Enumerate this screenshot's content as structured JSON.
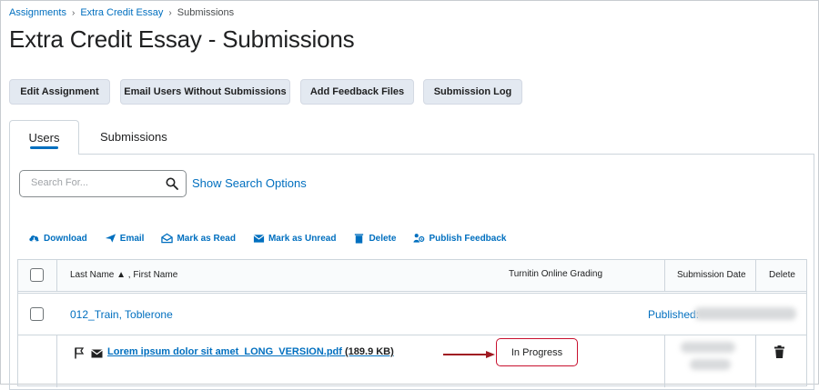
{
  "breadcrumb": {
    "items": [
      "Assignments",
      "Extra Credit Essay"
    ],
    "current": "Submissions"
  },
  "page": {
    "title": "Extra Credit Essay - Submissions"
  },
  "toolbar": {
    "edit_assignment": "Edit Assignment",
    "email_users": "Email Users Without Submissions",
    "add_feedback_files": "Add Feedback Files",
    "submission_log": "Submission Log"
  },
  "tabs": {
    "users": "Users",
    "submissions": "Submissions"
  },
  "search": {
    "placeholder": "Search For...",
    "show_options": "Show Search Options"
  },
  "actions": {
    "download": "Download",
    "email": "Email",
    "mark_read": "Mark as Read",
    "mark_unread": "Mark as Unread",
    "delete": "Delete",
    "publish_feedback": "Publish Feedback"
  },
  "table": {
    "headers": {
      "name": "Last Name ▲ , First Name",
      "turnitin": "Turnitin Online Grading",
      "submission_date": "Submission Date",
      "delete": "Delete"
    },
    "user_row": {
      "name": "012_Train, Toblerone",
      "published_label": "Published:"
    },
    "file_row": {
      "file_name": "Lorem ipsum dolor sit amet_LONG_VERSION.pdf",
      "file_size": " (189.9 KB)",
      "status": "In Progress"
    }
  },
  "colors": {
    "link": "#006fbf",
    "button_bg": "#e3e9f1",
    "highlight": "#c8102e",
    "annotation_arrow": "#a01922"
  }
}
